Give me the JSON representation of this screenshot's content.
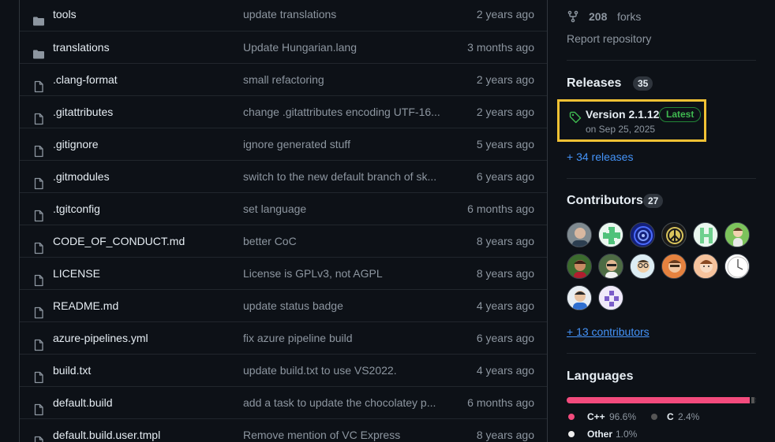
{
  "files": [
    {
      "name": "tools",
      "type": "folder",
      "message": "update translations",
      "age": "2 years ago"
    },
    {
      "name": "translations",
      "type": "folder",
      "message": "Update Hungarian.lang",
      "age": "3 months ago"
    },
    {
      "name": ".clang-format",
      "type": "file",
      "message": "small refactoring",
      "age": "2 years ago"
    },
    {
      "name": ".gitattributes",
      "type": "file",
      "message": "change .gitattributes encoding UTF-16...",
      "age": "2 years ago"
    },
    {
      "name": ".gitignore",
      "type": "file",
      "message": "ignore generated stuff",
      "age": "5 years ago"
    },
    {
      "name": ".gitmodules",
      "type": "file",
      "message": "switch to the new default branch of sk...",
      "age": "6 years ago"
    },
    {
      "name": ".tgitconfig",
      "type": "file",
      "message": "set language",
      "age": "6 months ago"
    },
    {
      "name": "CODE_OF_CONDUCT.md",
      "type": "file",
      "message": "better CoC",
      "age": "8 years ago"
    },
    {
      "name": "LICENSE",
      "type": "file",
      "message": "License is GPLv3, not AGPL",
      "age": "8 years ago"
    },
    {
      "name": "README.md",
      "type": "file",
      "message": "update status badge",
      "age": "4 years ago"
    },
    {
      "name": "azure-pipelines.yml",
      "type": "file",
      "message": "fix azure pipeline build",
      "age": "6 years ago"
    },
    {
      "name": "build.txt",
      "type": "file",
      "message": "update build.txt to use VS2022.",
      "age": "4 years ago"
    },
    {
      "name": "default.build",
      "type": "file",
      "message": "add a task to update the chocolatey p...",
      "age": "6 months ago"
    },
    {
      "name": "default.build.user.tmpl",
      "type": "file",
      "message": "Remove mention of VC Express",
      "age": "8 years ago"
    }
  ],
  "sidebar": {
    "forks_count": "208",
    "forks_label": "forks",
    "report_label": "Report repository",
    "releases": {
      "title": "Releases",
      "count": "35",
      "latest_name": "Version 2.1.12",
      "latest_badge": "Latest",
      "latest_date": "on Sep 25, 2025",
      "more_label": "+ 34 releases"
    },
    "contributors": {
      "title": "Contributors",
      "count": "27",
      "more_label": "+ 13 contributors"
    },
    "languages": {
      "title": "Languages",
      "items": [
        {
          "name": "C++",
          "percent": "96.6%",
          "color": "#f34b7d",
          "share": 96.6
        },
        {
          "name": "C",
          "percent": "2.4%",
          "color": "#555555",
          "share": 2.4
        },
        {
          "name": "Other",
          "percent": "1.0%",
          "color": "#ededed",
          "share": 1.0
        }
      ]
    }
  },
  "colors": {
    "background": "#0d1117",
    "border": "#30363d",
    "muted_text": "#8d96a0",
    "link": "#4493f8",
    "highlight": "#f0c134",
    "latest_green": "#3fb950"
  }
}
